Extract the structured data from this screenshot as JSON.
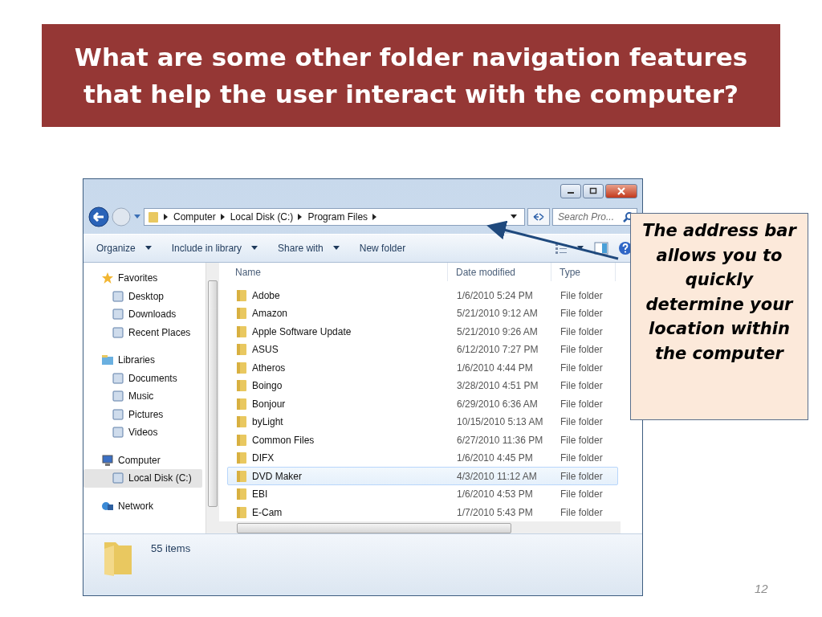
{
  "slide": {
    "title": "What are some other folder navigation features that help the user interact with the computer?",
    "page_number": "12"
  },
  "callout": {
    "text": "The address bar allows you to quickly determine your location within the computer"
  },
  "window": {
    "address": {
      "crumbs": [
        "Computer",
        "Local Disk (C:)",
        "Program Files"
      ]
    },
    "search": {
      "placeholder": "Search Pro..."
    },
    "toolbar": [
      {
        "label": "Organize",
        "dropdown": true
      },
      {
        "label": "Include in library",
        "dropdown": true
      },
      {
        "label": "Share with",
        "dropdown": true
      },
      {
        "label": "New folder",
        "dropdown": false
      }
    ],
    "nav_pane": [
      {
        "label": "Favorites",
        "selected": false,
        "children": [
          {
            "label": "Desktop",
            "selected": false
          },
          {
            "label": "Downloads",
            "selected": false
          },
          {
            "label": "Recent Places",
            "selected": false
          }
        ]
      },
      {
        "label": "Libraries",
        "selected": false,
        "children": [
          {
            "label": "Documents",
            "selected": false
          },
          {
            "label": "Music",
            "selected": false
          },
          {
            "label": "Pictures",
            "selected": false
          },
          {
            "label": "Videos",
            "selected": false
          }
        ]
      },
      {
        "label": "Computer",
        "selected": false,
        "children": [
          {
            "label": "Local Disk (C:)",
            "selected": true
          }
        ]
      },
      {
        "label": "Network",
        "selected": false
      }
    ],
    "columns": [
      "Name",
      "Date modified",
      "Type"
    ],
    "rows": [
      {
        "name": "Adobe",
        "date": "1/6/2010 5:24 PM",
        "type": "File folder",
        "selected": false
      },
      {
        "name": "Amazon",
        "date": "5/21/2010 9:12 AM",
        "type": "File folder",
        "selected": false
      },
      {
        "name": "Apple Software Update",
        "date": "5/21/2010 9:26 AM",
        "type": "File folder",
        "selected": false
      },
      {
        "name": "ASUS",
        "date": "6/12/2010 7:27 PM",
        "type": "File folder",
        "selected": false
      },
      {
        "name": "Atheros",
        "date": "1/6/2010 4:44 PM",
        "type": "File folder",
        "selected": false
      },
      {
        "name": "Boingo",
        "date": "3/28/2010 4:51 PM",
        "type": "File folder",
        "selected": false
      },
      {
        "name": "Bonjour",
        "date": "6/29/2010 6:36 AM",
        "type": "File folder",
        "selected": false
      },
      {
        "name": "byLight",
        "date": "10/15/2010 5:13 AM",
        "type": "File folder",
        "selected": false
      },
      {
        "name": "Common Files",
        "date": "6/27/2010 11:36 PM",
        "type": "File folder",
        "selected": false
      },
      {
        "name": "DIFX",
        "date": "1/6/2010 4:45 PM",
        "type": "File folder",
        "selected": false
      },
      {
        "name": "DVD Maker",
        "date": "4/3/2010 11:12 AM",
        "type": "File folder",
        "selected": true
      },
      {
        "name": "EBI",
        "date": "1/6/2010 4:53 PM",
        "type": "File folder",
        "selected": false
      },
      {
        "name": "E-Cam",
        "date": "1/7/2010 5:43 PM",
        "type": "File folder",
        "selected": false
      }
    ],
    "status": {
      "count": "55 items"
    }
  }
}
